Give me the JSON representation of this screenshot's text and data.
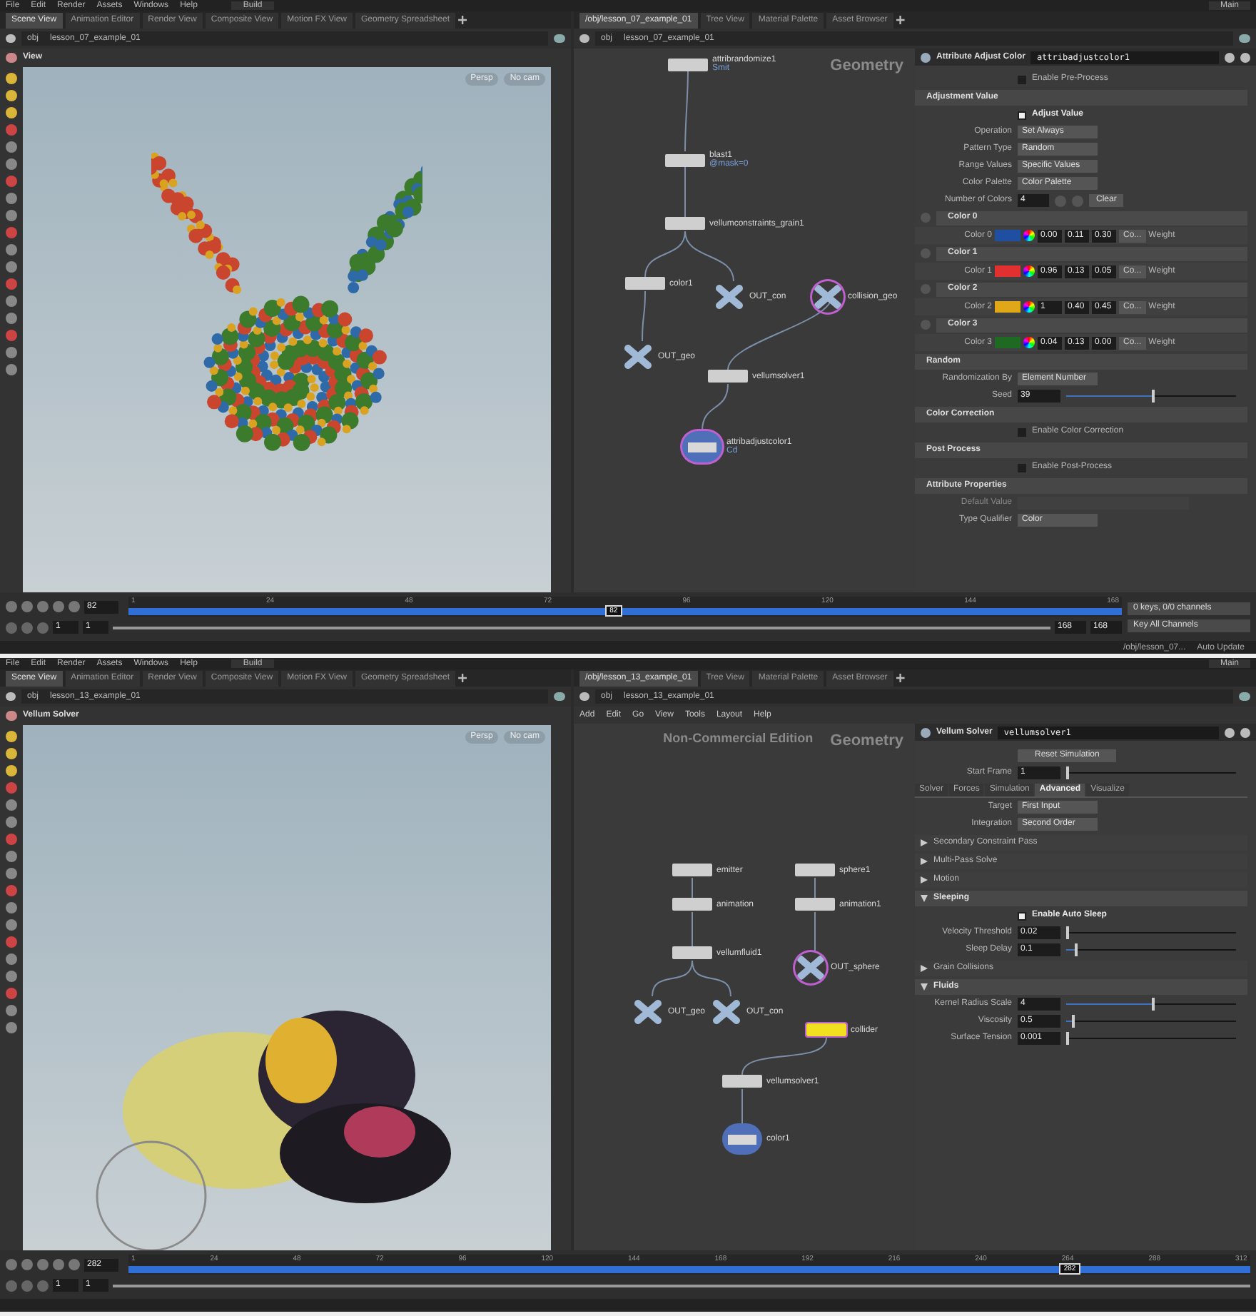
{
  "screens": [
    {
      "menu": [
        "File",
        "Edit",
        "Render",
        "Assets",
        "Windows",
        "Help"
      ],
      "desktop": "Build",
      "shelf": "Main",
      "scene_tabs": [
        {
          "label": "Scene View",
          "selected": true
        },
        {
          "label": "Animation Editor",
          "selected": false
        },
        {
          "label": "Render View",
          "selected": false
        },
        {
          "label": "Composite View",
          "selected": false
        },
        {
          "label": "Motion FX View",
          "selected": false
        },
        {
          "label": "Geometry Spreadsheet",
          "selected": false
        }
      ],
      "path": [
        "obj",
        "lesson_07_example_01"
      ],
      "viewport": {
        "title": "View",
        "kind": "balls",
        "buttons": [
          "Persp",
          "No cam"
        ]
      },
      "network_tabs": [
        {
          "label": "/obj/lesson_07_example_01",
          "selected": true
        },
        {
          "label": "Tree View",
          "selected": false
        },
        {
          "label": "Material Palette",
          "selected": false
        },
        {
          "label": "Asset Browser",
          "selected": false
        }
      ],
      "network_path": [
        "obj",
        "lesson_07_example_01"
      ],
      "graph_labels": [
        "Geometry"
      ],
      "nodes": [
        {
          "name": "attribrandomize1",
          "kind": "box",
          "note": "Smit",
          "selected": false
        },
        {
          "name": "blast1",
          "kind": "box",
          "note": "@mask=0",
          "selected": false
        },
        {
          "name": "vellumconstraints_grain1",
          "kind": "box",
          "selected": false
        },
        {
          "name": "color1",
          "kind": "box",
          "selected": false
        },
        {
          "name": "OUT_con",
          "kind": "null",
          "selected": false
        },
        {
          "name": "collision_geo",
          "kind": "null",
          "selected": true
        },
        {
          "name": "OUT_geo",
          "kind": "null",
          "selected": false
        },
        {
          "name": "vellumsolver1",
          "kind": "box",
          "selected": false
        },
        {
          "name": "attribadjustcolor1",
          "kind": "round",
          "note": "Cd",
          "selected": true
        }
      ],
      "params": {
        "type": "Attribute Adjust Color",
        "node": "attribadjustcolor1",
        "rows": [
          {
            "kind": "check",
            "label": "Enable Pre-Process",
            "checked": false
          },
          {
            "kind": "header",
            "label": "Adjustment Value"
          },
          {
            "kind": "check",
            "label": "Adjust Value",
            "checked": true
          },
          {
            "kind": "menu",
            "label": "Operation",
            "value": "Set Always"
          },
          {
            "kind": "menu",
            "label": "Pattern Type",
            "value": "Random"
          },
          {
            "kind": "menu",
            "label": "Range Values",
            "value": "Specific Values"
          },
          {
            "kind": "menu",
            "label": "Color Palette",
            "value": "Color Palette"
          },
          {
            "kind": "number",
            "label": "Number of Colors",
            "value": "4",
            "button": "Clear"
          },
          {
            "kind": "group",
            "label": "Color 0"
          },
          {
            "kind": "color",
            "label": "Color 0",
            "color": "#1f4fa0",
            "values": [
              "0.00",
              "0.11",
              "0.30"
            ],
            "menu": "Co...",
            "tail": "Weight"
          },
          {
            "kind": "group",
            "label": "Color 1"
          },
          {
            "kind": "color",
            "label": "Color 1",
            "color": "#e03030",
            "values": [
              "0.96",
              "0.13",
              "0.05"
            ],
            "menu": "Co...",
            "tail": "Weight"
          },
          {
            "kind": "group",
            "label": "Color 2"
          },
          {
            "kind": "color",
            "label": "Color 2",
            "color": "#e0a818",
            "values": [
              "1",
              "0.40",
              "0.45"
            ],
            "menu": "Co...",
            "tail": "Weight"
          },
          {
            "kind": "group",
            "label": "Color 3"
          },
          {
            "kind": "color",
            "label": "Color 3",
            "color": "#1e6a22",
            "values": [
              "0.04",
              "0.13",
              "0.00"
            ],
            "menu": "Co...",
            "tail": "Weight"
          },
          {
            "kind": "header",
            "label": "Random"
          },
          {
            "kind": "menu",
            "label": "Randomization By",
            "value": "Element Number"
          },
          {
            "kind": "slider",
            "label": "Seed",
            "value": "39",
            "level": 0.5
          },
          {
            "kind": "header",
            "label": "Color Correction"
          },
          {
            "kind": "check",
            "label": "Enable Color Correction",
            "checked": false
          },
          {
            "kind": "header",
            "label": "Post Process"
          },
          {
            "kind": "check",
            "label": "Enable Post-Process",
            "checked": false
          },
          {
            "kind": "header",
            "label": "Attribute Properties"
          },
          {
            "kind": "label",
            "label": "Default Value"
          },
          {
            "kind": "menu",
            "label": "Type Qualifier",
            "value": "Color"
          }
        ]
      },
      "timeline": {
        "frame": "82",
        "ticks": [
          "1",
          "24",
          "48",
          "72",
          "96",
          "120",
          "144",
          "168"
        ],
        "marker": "82",
        "level": 0.48,
        "range": {
          "level": 1
        },
        "start": "1",
        "end": "1",
        "range_start": "168",
        "range_end": "168",
        "keys": [
          "0 keys, 0/0 channels",
          "Key All Channels"
        ]
      },
      "status": [
        "/obj/lesson_07...",
        "Auto Update"
      ]
    },
    {
      "menu": [
        "File",
        "Edit",
        "Render",
        "Assets",
        "Windows",
        "Help"
      ],
      "desktop": "Build",
      "shelf": "Main",
      "scene_tabs": [
        {
          "label": "Scene View",
          "selected": true
        },
        {
          "label": "Animation Editor",
          "selected": false
        },
        {
          "label": "Render View",
          "selected": false
        },
        {
          "label": "Composite View",
          "selected": false
        },
        {
          "label": "Motion FX View",
          "selected": false
        },
        {
          "label": "Geometry Spreadsheet",
          "selected": false
        }
      ],
      "path": [
        "obj",
        "lesson_13_example_01"
      ],
      "viewport": {
        "title": "Vellum Solver",
        "kind": "fluid",
        "buttons": [
          "Persp",
          "No cam"
        ]
      },
      "network_tabs": [
        {
          "label": "/obj/lesson_13_example_01",
          "selected": true
        },
        {
          "label": "Tree View",
          "selected": false
        },
        {
          "label": "Material Palette",
          "selected": false
        },
        {
          "label": "Asset Browser",
          "selected": false
        }
      ],
      "network_path": [
        "obj",
        "lesson_13_example_01"
      ],
      "network_menu": [
        "Add",
        "Edit",
        "Go",
        "View",
        "Tools",
        "Layout",
        "Help"
      ],
      "graph_labels": [
        "Non-Commercial Edition",
        "Geometry"
      ],
      "nodes": [
        {
          "name": "emitter",
          "kind": "box",
          "selected": false
        },
        {
          "name": "animation",
          "kind": "box",
          "selected": false
        },
        {
          "name": "vellumfluid1",
          "kind": "box",
          "selected": false
        },
        {
          "name": "OUT_geo",
          "kind": "null",
          "selected": false
        },
        {
          "name": "OUT_con",
          "kind": "null",
          "selected": false
        },
        {
          "name": "sphere1",
          "kind": "box",
          "selected": false
        },
        {
          "name": "animation1",
          "kind": "box",
          "selected": false
        },
        {
          "name": "OUT_sphere",
          "kind": "null",
          "selected": true
        },
        {
          "name": "collider",
          "kind": "box",
          "selected": true
        },
        {
          "name": "vellumsolver1",
          "kind": "box",
          "selected": false
        },
        {
          "name": "color1",
          "kind": "round",
          "selected": false
        }
      ],
      "params": {
        "type": "Vellum Solver",
        "node": "vellumsolver1",
        "rows": [
          {
            "kind": "button",
            "label": "Reset Simulation"
          },
          {
            "kind": "slider",
            "label": "Start Frame",
            "value": "1",
            "level": 0
          },
          {
            "kind": "tabs",
            "tabs": [
              {
                "label": "Solver",
                "selected": false
              },
              {
                "label": "Forces",
                "selected": false
              },
              {
                "label": "Simulation",
                "selected": false
              },
              {
                "label": "Advanced",
                "selected": true
              },
              {
                "label": "Visualize",
                "selected": false
              }
            ]
          },
          {
            "kind": "menu",
            "label": "Target",
            "value": "First Input"
          },
          {
            "kind": "menu",
            "label": "Integration",
            "value": "Second Order"
          },
          {
            "kind": "fold",
            "label": "Secondary Constraint Pass",
            "expanded": false
          },
          {
            "kind": "fold",
            "label": "Multi-Pass Solve",
            "expanded": false
          },
          {
            "kind": "fold",
            "label": "Motion",
            "expanded": false
          },
          {
            "kind": "fold",
            "label": "Sleeping",
            "expanded": true
          },
          {
            "kind": "check",
            "label": "Enable Auto Sleep",
            "checked": true
          },
          {
            "kind": "slider",
            "label": "Velocity Threshold",
            "value": "0.02",
            "level": 0
          },
          {
            "kind": "slider",
            "label": "Sleep Delay",
            "value": "0.1",
            "level": 0.05
          },
          {
            "kind": "fold",
            "label": "Grain Collisions",
            "expanded": false
          },
          {
            "kind": "fold",
            "label": "Fluids",
            "expanded": true
          },
          {
            "kind": "slider",
            "label": "Kernel Radius Scale",
            "value": "4",
            "level": 0.5
          },
          {
            "kind": "slider",
            "label": "Viscosity",
            "value": "0.5",
            "level": 0.03
          },
          {
            "kind": "slider",
            "label": "Surface Tension",
            "value": "0.001",
            "level": 0
          }
        ]
      },
      "timeline": {
        "frame": "282",
        "ticks": [
          "1",
          "24",
          "48",
          "72",
          "96",
          "120",
          "144",
          "168",
          "192",
          "216",
          "240",
          "264",
          "288",
          "312"
        ],
        "marker": "282",
        "level": 0.83,
        "range": {
          "level": 1
        },
        "start": "1",
        "end": "1"
      }
    }
  ]
}
